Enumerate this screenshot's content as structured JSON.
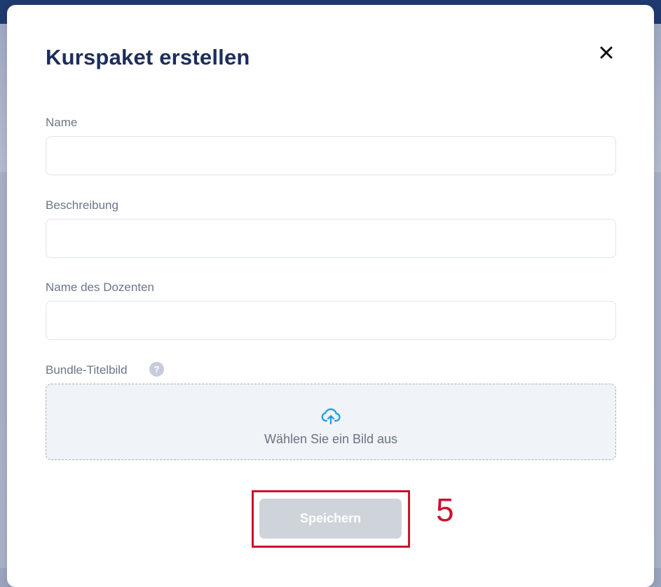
{
  "modal": {
    "title": "Kurspaket erstellen",
    "close_icon": "close-icon"
  },
  "form": {
    "name_label": "Name",
    "name_value": "",
    "description_label": "Beschreibung",
    "description_value": "",
    "instructor_label": "Name des Dozenten",
    "instructor_value": "",
    "cover_label": "Bundle-Titelbild",
    "help_icon": "help-icon",
    "help_glyph": "?",
    "upload_icon": "cloud-upload-icon",
    "upload_text": "Wählen Sie ein Bild aus"
  },
  "actions": {
    "save_label": "Speichern"
  },
  "annotation": {
    "step_number": "5"
  },
  "colors": {
    "title": "#1d2d5c",
    "accent_blue": "#1a9be6",
    "disabled_button": "#cfd4da",
    "highlight_red": "#c8142e"
  }
}
